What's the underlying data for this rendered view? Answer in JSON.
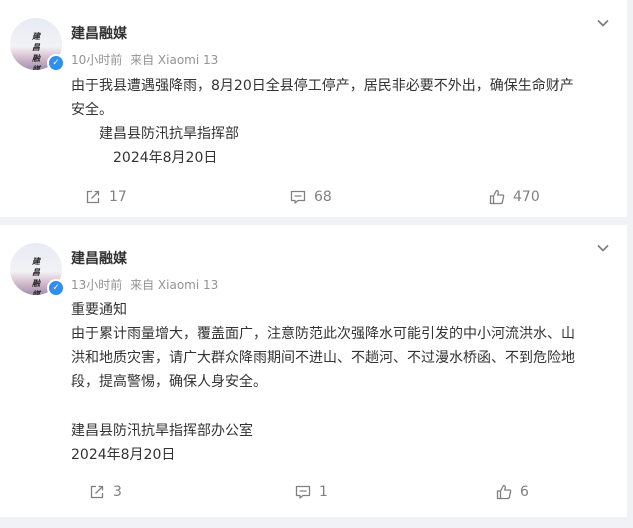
{
  "posts": [
    {
      "author": "建昌融媒",
      "avatar_text": [
        "建",
        "昌",
        "融",
        "媒"
      ],
      "time": "10小时前",
      "source": "来自 Xiaomi 13",
      "lines": [
        "由于我县遭遇强降雨，8月20日全县停工停产，居民非必要不外出，确保生命财产",
        "安全。",
        "　　建昌县防汛抗旱指挥部",
        "　　　2024年8月20日"
      ],
      "reposts": "17",
      "comments": "68",
      "likes": "470"
    },
    {
      "author": "建昌融媒",
      "avatar_text": [
        "建",
        "昌",
        "融",
        "媒"
      ],
      "time": "13小时前",
      "source": "来自 Xiaomi 13",
      "lines": [
        "重要通知",
        "由于累计雨量增大，覆盖面广，注意防范此次强降水可能引发的中小河流洪水、山",
        "洪和地质灾害，请广大群众降雨期间不进山、不趟河、不过漫水桥函、不到危险地",
        "段，提高警惕，确保人身安全。",
        "",
        "建昌县防汛抗旱指挥部办公室",
        "2024年8月20日"
      ],
      "reposts": "3",
      "comments": "1",
      "likes": "6"
    }
  ],
  "colors": {
    "page_background": "#f1f2f5",
    "card_background": "#ffffff",
    "text": "#333333",
    "meta": "#939393",
    "verified_badge": "#2f8ef0"
  },
  "icons": [
    "chevron-down-icon",
    "verified-badge-icon",
    "repost-icon",
    "comment-icon",
    "like-icon"
  ]
}
